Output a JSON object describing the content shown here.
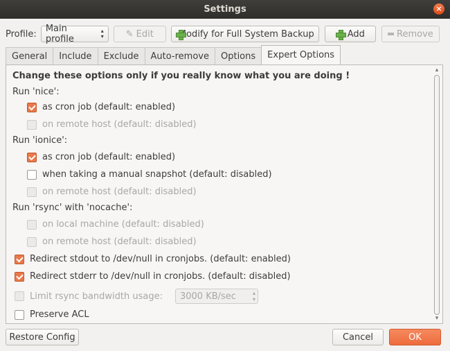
{
  "window": {
    "title": "Settings"
  },
  "toolbar": {
    "profile_label": "Profile:",
    "profile_value": "Main profile",
    "edit_label": "Edit",
    "modify_label": "Modify for Full System Backup",
    "add_label": "Add",
    "remove_label": "Remove"
  },
  "tabs": [
    "General",
    "Include",
    "Exclude",
    "Auto-remove",
    "Options",
    "Expert Options"
  ],
  "active_tab": "Expert Options",
  "expert": {
    "warning": "Change these options only if you really know what you are doing !",
    "nice_heading": "Run 'nice':",
    "nice_cron": "as cron job (default: enabled)",
    "nice_remote": "on remote host (default: disabled)",
    "ionice_heading": "Run 'ionice':",
    "ionice_cron": "as cron job (default: enabled)",
    "ionice_manual": "when taking a manual snapshot (default: disabled)",
    "ionice_remote": "on remote host (default: disabled)",
    "nocache_heading": "Run 'rsync' with 'nocache':",
    "nocache_local": "on local machine (default: disabled)",
    "nocache_remote": "on remote host (default: disabled)",
    "stdout": "Redirect stdout to /dev/null in cronjobs. (default: enabled)",
    "stderr": "Redirect stderr to /dev/null in cronjobs. (default: disabled)",
    "bwlimit_label": "Limit rsync bandwidth usage:",
    "bwlimit_value": "3000 KB/sec",
    "acl": "Preserve ACL"
  },
  "checkbox_state": {
    "nice_cron": true,
    "nice_remote": false,
    "ionice_cron": true,
    "ionice_manual": false,
    "ionice_remote": false,
    "nocache_local": false,
    "nocache_remote": false,
    "stdout": true,
    "stderr": true,
    "bwlimit": false,
    "acl": false
  },
  "footer": {
    "restore_label": "Restore Config",
    "cancel_label": "Cancel",
    "ok_label": "OK"
  },
  "icons": {
    "close": "close-icon",
    "edit": "pencil-icon",
    "add": "plus-icon",
    "remove": "minus-icon",
    "combo": "updown-arrows-icon"
  },
  "colors": {
    "accent": "#e9794b",
    "titlebar": "#3a3935",
    "add_icon": "#6ab04c"
  }
}
